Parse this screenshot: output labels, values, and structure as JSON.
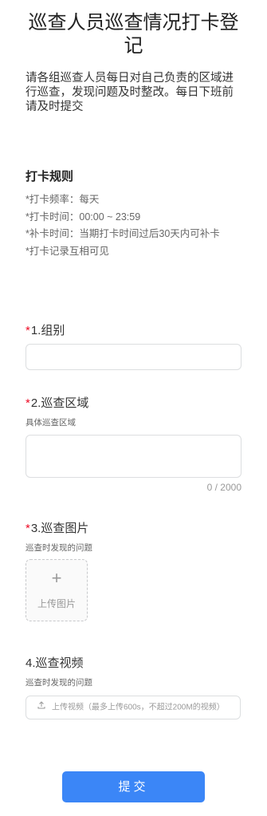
{
  "form": {
    "title": "巡查人员巡查情况打卡登记",
    "intro": "请各组巡查人员每日对自己负责的区域进行巡查，发现问题及时整改。每日下班前请及时提交"
  },
  "rules": {
    "title": "打卡规则",
    "items": [
      "*打卡频率：每天",
      "*打卡时间：00:00 ~ 23:59",
      "*补卡时间：当期打卡时间过后30天内可补卡",
      "*打卡记录互相可见"
    ]
  },
  "questions": {
    "q1": {
      "required_mark": "*",
      "label": "1.组别",
      "value": ""
    },
    "q2": {
      "required_mark": "*",
      "label": "2.巡查区域",
      "desc": "具体巡查区域",
      "value": "",
      "counter": "0 / 2000"
    },
    "q3": {
      "required_mark": "*",
      "label": "3.巡查图片",
      "desc": "巡查时发现的问题",
      "upload_icon": "+",
      "upload_text": "上传图片"
    },
    "q4": {
      "label": "4.巡查视频",
      "desc": "巡查时发现的问题",
      "upload_text": "上传视频（最多上传600s，不超过200M的视频）"
    }
  },
  "submit": {
    "label": "提交",
    "color": "#3b86f7"
  },
  "colors": {
    "required": "#ee0a24",
    "border": "#dcdee0"
  }
}
